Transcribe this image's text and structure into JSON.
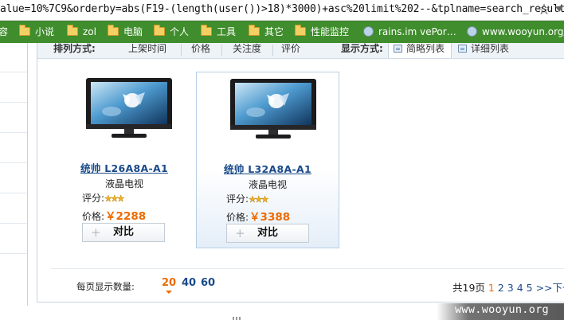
{
  "browser": {
    "url": "alue=10%7C9&orderby=abs(F19-(length(user())>18)*3000)+asc%20limit%202--&tplname=search_result.sh",
    "bookmarks": [
      {
        "label": "容",
        "type": "text"
      },
      {
        "label": "小说",
        "type": "folder"
      },
      {
        "label": "zol",
        "type": "folder"
      },
      {
        "label": "电脑",
        "type": "folder"
      },
      {
        "label": "个人",
        "type": "folder"
      },
      {
        "label": "工具",
        "type": "folder"
      },
      {
        "label": "其它",
        "type": "folder"
      },
      {
        "label": "性能监控",
        "type": "folder"
      },
      {
        "label": "rains.im vePor…",
        "type": "site"
      },
      {
        "label": "www.wooyun.org/",
        "type": "site"
      }
    ]
  },
  "sortbar": {
    "label": "排列方式:",
    "options": [
      "上架时间",
      "价格",
      "关注度",
      "评价"
    ],
    "view_label": "显示方式:",
    "view_options": [
      "简略列表",
      "详细列表"
    ],
    "view_active": 0
  },
  "products": [
    {
      "name": "统帅 L26A8A-A1",
      "category": "液晶电视",
      "rating_label": "评分:",
      "stars": "★★★",
      "rating": 3,
      "price_label": "价格:",
      "price": "￥2288",
      "compare_label": "对比"
    },
    {
      "name": "统帅 L32A8A-A1",
      "category": "液晶电视",
      "rating_label": "评分:",
      "stars": "★★★",
      "rating": 3,
      "price_label": "价格:",
      "price": "￥3388",
      "compare_label": "对比"
    }
  ],
  "footer": {
    "per_page_label": "每页显示数量:",
    "per_page_options": [
      "20",
      "40",
      "60"
    ],
    "per_page_selected": "20",
    "total": "共19页",
    "pages": [
      "1",
      "2",
      "3",
      "4",
      "5"
    ],
    "current_page": "1",
    "next": ">>下一"
  },
  "watermark": "www.wooyun.org",
  "colors": {
    "bookmark_bar": "#3f8d2c",
    "link": "#1a4a8a",
    "price": "#ee6a00",
    "border": "#c6d3e1"
  }
}
